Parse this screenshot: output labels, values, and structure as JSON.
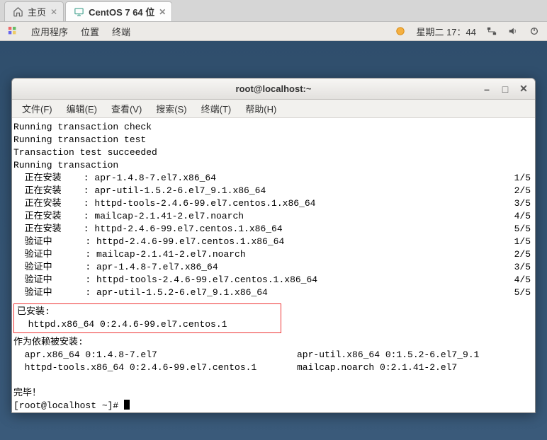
{
  "topTabs": {
    "home": {
      "label": "主页"
    },
    "vm": {
      "label": "CentOS 7 64 位"
    }
  },
  "gnome": {
    "apps": "应用程序",
    "places": "位置",
    "terminal": "终端",
    "clock": "星期二 17：44"
  },
  "window": {
    "title": "root@localhost:~"
  },
  "menu": {
    "file": "文件(F)",
    "edit": "编辑(E)",
    "view": "查看(V)",
    "search": "搜索(S)",
    "terminal": "终端(T)",
    "help": "帮助(H)"
  },
  "lines": {
    "l1": "Running transaction check",
    "l2": "Running transaction test",
    "l3": "Transaction test succeeded",
    "l4": "Running transaction",
    "install": "  正在安装    :",
    "verify": "  验证中      :",
    "p1": " apr-1.4.8-7.el7.x86_64",
    "p2": " apr-util-1.5.2-6.el7_9.1.x86_64",
    "p3": " httpd-tools-2.4.6-99.el7.centos.1.x86_64",
    "p4": " mailcap-2.1.41-2.el7.noarch",
    "p5": " httpd-2.4.6-99.el7.centos.1.x86_64",
    "c1": "1/5",
    "c2": "2/5",
    "c3": "3/5",
    "c4": "4/5",
    "c5": "5/5",
    "installedHdr": "已安装:",
    "installedPkg": "  httpd.x86_64 0:2.4.6-99.el7.centos.1",
    "depsHdr": "作为依赖被安装:",
    "dep1a": "  apr.x86_64 0:1.4.8-7.el7",
    "dep1b": "apr-util.x86_64 0:1.5.2-6.el7_9.1",
    "dep2a": "  httpd-tools.x86_64 0:2.4.6-99.el7.centos.1",
    "dep2b": "mailcap.noarch 0:2.1.41-2.el7",
    "done": "完毕！",
    "prompt": "[root@localhost ~]# "
  }
}
